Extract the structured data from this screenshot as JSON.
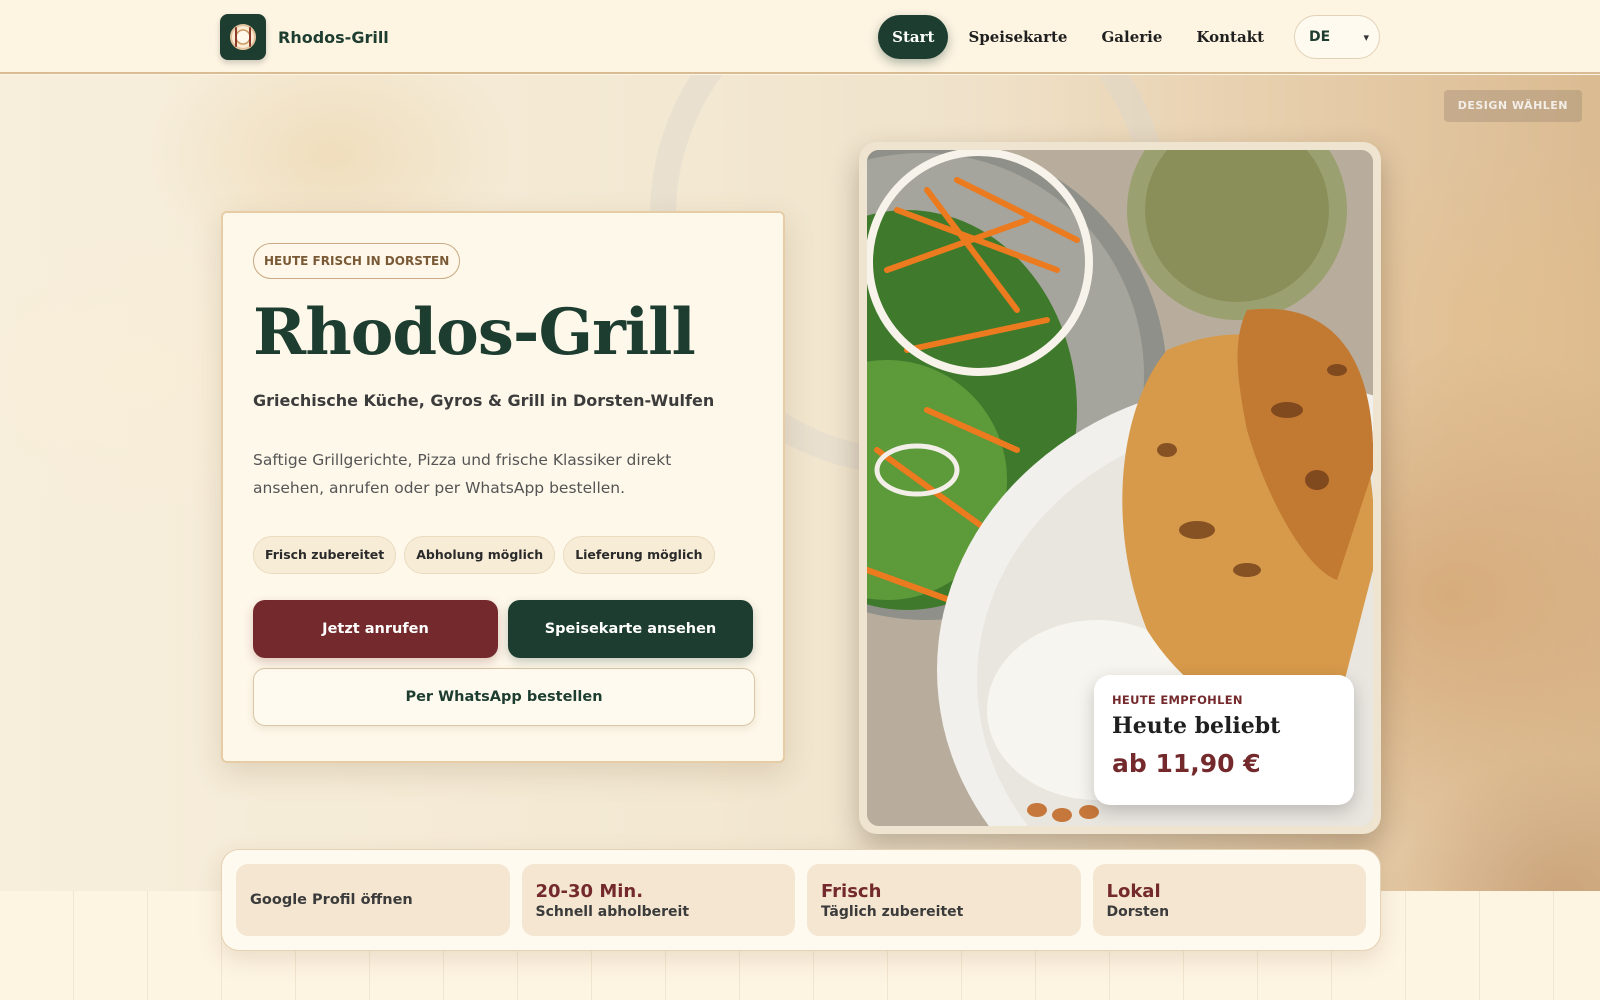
{
  "header": {
    "brand_name": "Rhodos-Grill",
    "nav": [
      {
        "label": "Start",
        "active": true
      },
      {
        "label": "Speisekarte",
        "active": false
      },
      {
        "label": "Galerie",
        "active": false
      },
      {
        "label": "Kontakt",
        "active": false
      }
    ],
    "language": "DE"
  },
  "design_button_label": "DESIGN WÄHLEN",
  "hero": {
    "eyebrow": "HEUTE FRISCH IN DORSTEN",
    "title": "Rhodos-Grill",
    "subtitle": "Griechische Küche, Gyros & Grill in Dorsten-Wulfen",
    "description": "Saftige Grillgerichte, Pizza und frische Klassiker direkt ansehen, anrufen oder per WhatsApp bestellen.",
    "pills": [
      "Frisch zubereitet",
      "Abholung möglich",
      "Lieferung möglich"
    ],
    "buttons": {
      "call": "Jetzt anrufen",
      "menu": "Speisekarte ansehen",
      "whatsapp": "Per WhatsApp bestellen"
    }
  },
  "recommendation": {
    "eyebrow": "HEUTE EMPFOHLEN",
    "title": "Heute beliebt",
    "price": "ab 11,90 €"
  },
  "stats": [
    {
      "value": "",
      "label": "Google Profil öffnen"
    },
    {
      "value": "20-30 Min.",
      "label": "Schnell abholbereit"
    },
    {
      "value": "Frisch",
      "label": "Täglich zubereitet"
    },
    {
      "value": "Lokal",
      "label": "Dorsten"
    }
  ],
  "colors": {
    "brand_green": "#1d3d30",
    "accent_red": "#742a2c",
    "cream": "#fdf4e2"
  }
}
